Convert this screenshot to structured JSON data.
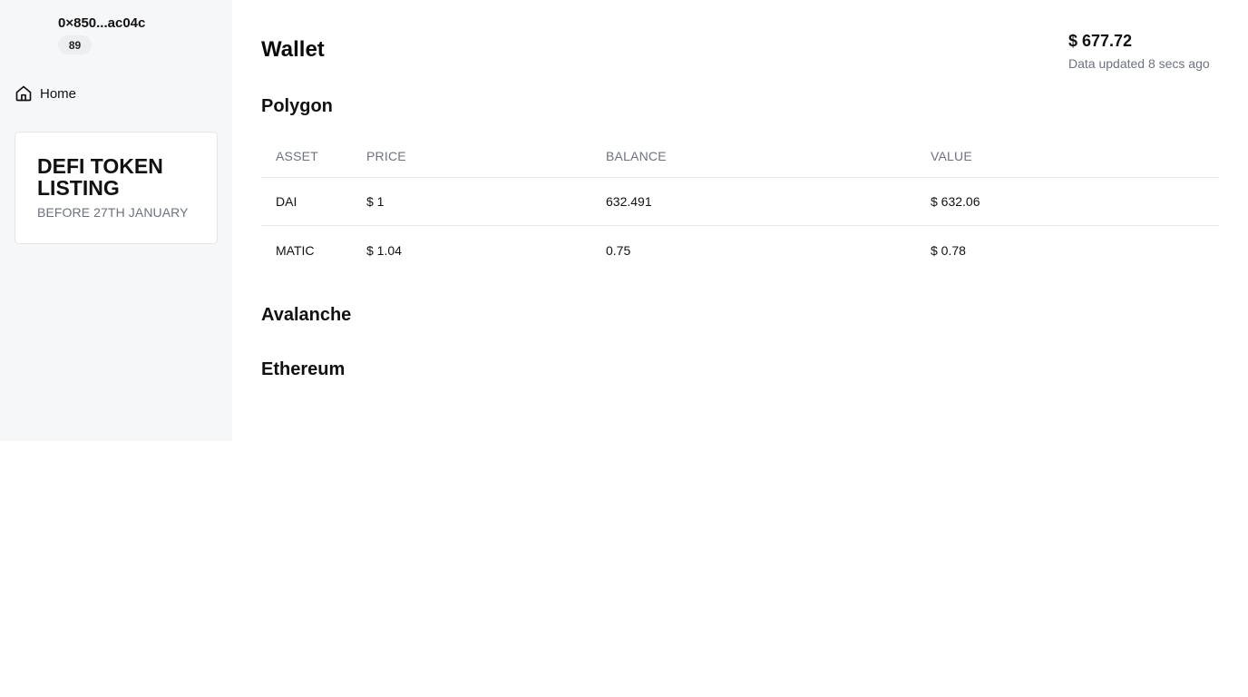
{
  "sidebar": {
    "account": {
      "address": "0×850...ac04c",
      "badge": "89"
    },
    "nav": [
      {
        "label": "Home",
        "icon": "home-icon"
      }
    ],
    "promo": {
      "title": "DEFI TOKEN LISTING",
      "subtitle": "BEFORE 27TH JANUARY"
    }
  },
  "main": {
    "title": "Wallet",
    "total_value": "$ 677.72",
    "updated": "Data updated 8 secs ago",
    "sections": [
      {
        "name": "Polygon",
        "columns": [
          "ASSET",
          "PRICE",
          "BALANCE",
          "VALUE"
        ],
        "rows": [
          {
            "asset": "DAI",
            "price": "$ 1",
            "balance": "632.491",
            "value": "$ 632.06"
          },
          {
            "asset": "MATIC",
            "price": "$ 1.04",
            "balance": "0.75",
            "value": "$ 0.78"
          }
        ]
      },
      {
        "name": "Avalanche"
      },
      {
        "name": "Ethereum"
      }
    ]
  },
  "colors": {
    "sidebar_bg": "#f6f7f9",
    "muted_text": "#6b7280",
    "border": "#e5e7eb"
  }
}
